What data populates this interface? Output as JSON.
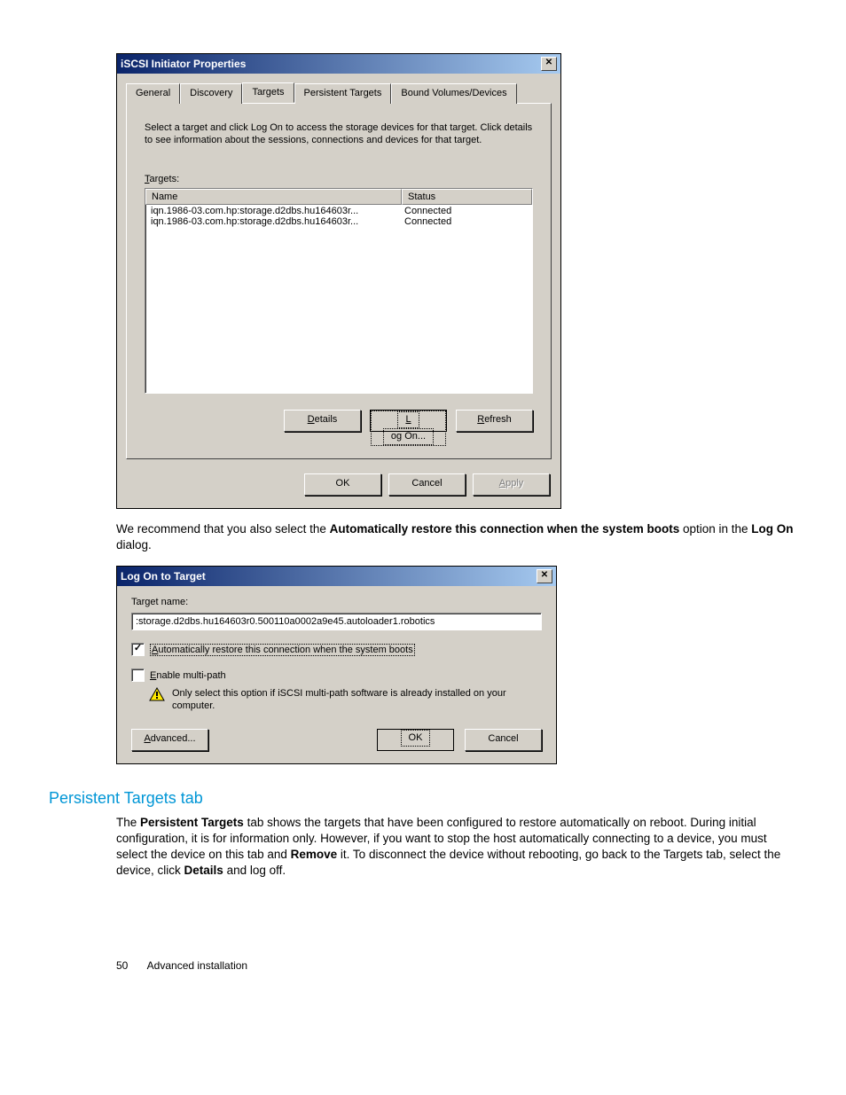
{
  "dialog1": {
    "title": "iSCSI Initiator Properties",
    "close": "✕",
    "tabs": [
      "General",
      "Discovery",
      "Targets",
      "Persistent Targets",
      "Bound Volumes/Devices"
    ],
    "description": "Select a target and click Log On to access the storage devices for that target. Click details to see information about the sessions, connections and devices for that target.",
    "targets_label_u": "T",
    "targets_label_rest": "argets:",
    "header_name": "Name",
    "header_status": "Status",
    "rows": [
      {
        "name": "iqn.1986-03.com.hp:storage.d2dbs.hu164603r...",
        "status": "Connected"
      },
      {
        "name": "iqn.1986-03.com.hp:storage.d2dbs.hu164603r...",
        "status": "Connected"
      }
    ],
    "btn_details_u": "D",
    "btn_details_rest": "etails",
    "btn_logon_u": "L",
    "btn_logon_rest": "og On...",
    "btn_refresh_u": "R",
    "btn_refresh_rest": "efresh",
    "btn_ok": "OK",
    "btn_cancel": "Cancel",
    "btn_apply_u": "A",
    "btn_apply_rest": "pply"
  },
  "para1_pre": "We recommend that you also select the ",
  "para1_b1": "Automatically restore this connection when the system boots",
  "para1_mid": " option in the ",
  "para1_b2": "Log On",
  "para1_post": " dialog.",
  "dialog2": {
    "title": "Log On to Target",
    "close": "✕",
    "target_label": "Target name:",
    "target_value": ":storage.d2dbs.hu164603r0.500110a0002a9e45.autoloader1.robotics",
    "chk1_u": "A",
    "chk1_rest": "utomatically restore this connection when the system boots",
    "chk2_u": "E",
    "chk2_rest": "nable multi-path",
    "warn": "Only select this option if iSCSI multi-path software is already installed on your computer.",
    "btn_adv_u": "A",
    "btn_adv_rest": "dvanced...",
    "btn_ok": "OK",
    "btn_cancel": "Cancel"
  },
  "heading2": "Persistent Targets tab",
  "para2_pre": "The ",
  "para2_b1": "Persistent Targets",
  "para2_mid1": " tab shows the targets that have been configured to restore automatically on reboot. During initial configuration, it is for information only. However, if you want to stop the host automatically connecting to a device, you must select the device on this tab and ",
  "para2_b2": "Remove",
  "para2_mid2": " it. To disconnect the device without rebooting, go back to the Targets tab, select the device, click ",
  "para2_b3": "Details",
  "para2_post": " and log off.",
  "footer_page": "50",
  "footer_text": "Advanced installation"
}
